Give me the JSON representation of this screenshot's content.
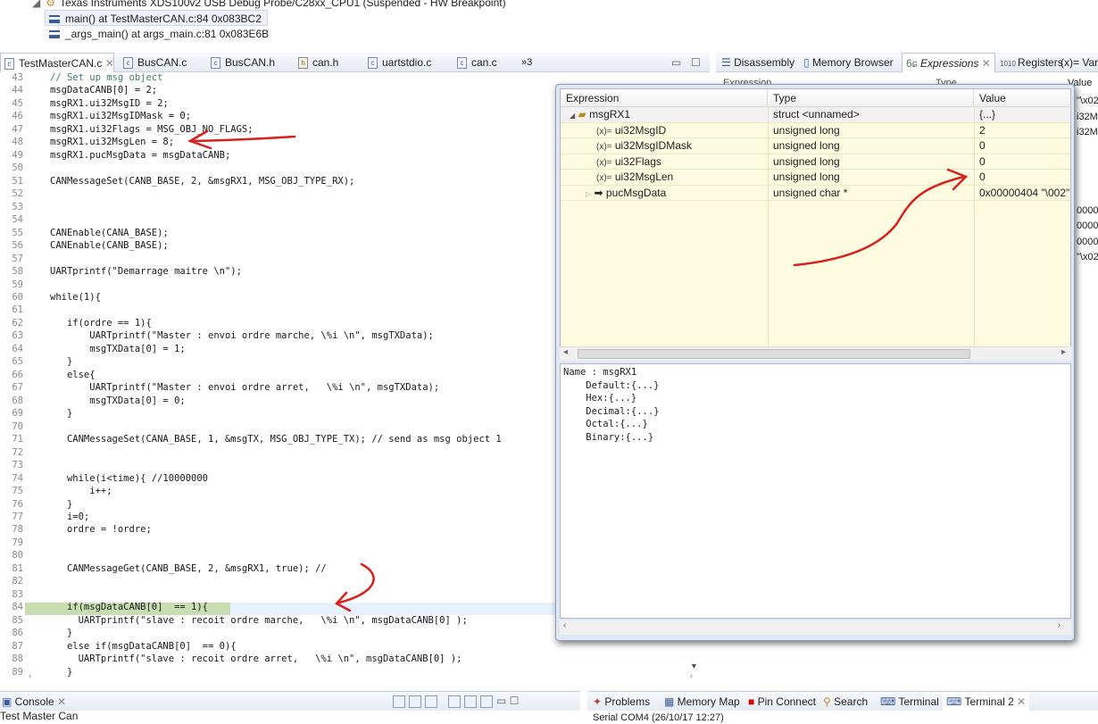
{
  "debug": {
    "target": "Texas Instruments XDS100v2 USB Debug Probe/C28xx_CPU1 (Suspended - HW Breakpoint)",
    "frames": [
      "main() at TestMasterCAN.c:84 0x083BC2",
      "_args_main() at args_main.c:81 0x083E6B"
    ]
  },
  "editor": {
    "tabs": [
      {
        "label": "TestMasterCAN.c",
        "icon": "c-file-icon",
        "active": true
      },
      {
        "label": "BusCAN.c",
        "icon": "c-file-icon"
      },
      {
        "label": "BusCAN.h",
        "icon": "c-file-icon"
      },
      {
        "label": "can.h",
        "icon": "h-file-icon"
      },
      {
        "label": "uartstdio.c",
        "icon": "c-file-icon"
      },
      {
        "label": "can.c",
        "icon": "c-file-icon"
      }
    ],
    "overflow": "»3",
    "current_line": 84,
    "lines": [
      [
        "43",
        "// Set up msg object"
      ],
      [
        "44",
        "msgDataCANB[0] = 2;"
      ],
      [
        "45",
        "msgRX1.ui32MsgID = 2;"
      ],
      [
        "46",
        "msgRX1.ui32MsgIDMask = 0;"
      ],
      [
        "47",
        "msgRX1.ui32Flags = MSG_OBJ_NO_FLAGS;"
      ],
      [
        "48",
        "msgRX1.ui32MsgLen = 8;"
      ],
      [
        "49",
        "msgRX1.pucMsgData = msgDataCANB;"
      ],
      [
        "50",
        ""
      ],
      [
        "51",
        "CANMessageSet(CANB_BASE, 2, &msgRX1, MSG_OBJ_TYPE_RX);"
      ],
      [
        "52",
        ""
      ],
      [
        "53",
        ""
      ],
      [
        "54",
        ""
      ],
      [
        "55",
        "CANEnable(CANA_BASE);"
      ],
      [
        "56",
        "CANEnable(CANB_BASE);"
      ],
      [
        "57",
        ""
      ],
      [
        "58",
        "UARTprintf(\"Demarrage maitre \\n\");"
      ],
      [
        "59",
        ""
      ],
      [
        "60",
        "while(1){"
      ],
      [
        "61",
        ""
      ],
      [
        "62",
        "   if(ordre == 1){"
      ],
      [
        "63",
        "       UARTprintf(\"Master : envoi ordre marche, \\%i \\n\", msgTXData);"
      ],
      [
        "64",
        "       msgTXData[0] = 1;"
      ],
      [
        "65",
        "   }"
      ],
      [
        "66",
        "   else{"
      ],
      [
        "67",
        "       UARTprintf(\"Master : envoi ordre arret,   \\%i \\n\", msgTXData);"
      ],
      [
        "68",
        "       msgTXData[0] = 0;"
      ],
      [
        "69",
        "   }"
      ],
      [
        "70",
        ""
      ],
      [
        "71",
        "   CANMessageSet(CANA_BASE, 1, &msgTX, MSG_OBJ_TYPE_TX); // send as msg object 1"
      ],
      [
        "72",
        ""
      ],
      [
        "73",
        ""
      ],
      [
        "74",
        "   while(i<time){ //10000000"
      ],
      [
        "75",
        "       i++;"
      ],
      [
        "76",
        "   }"
      ],
      [
        "77",
        "   i=0;"
      ],
      [
        "78",
        "   ordre = !ordre;"
      ],
      [
        "79",
        ""
      ],
      [
        "80",
        ""
      ],
      [
        "81",
        "   CANMessageGet(CANB_BASE, 2, &msgRX1, true); //"
      ],
      [
        "82",
        ""
      ],
      [
        "83",
        ""
      ],
      [
        "84",
        "   if(msgDataCANB[0]  == 1){"
      ],
      [
        "85",
        "     UARTprintf(\"slave : recoit ordre marche,   \\%i \\n\", msgDataCANB[0] );"
      ],
      [
        "86",
        "   }"
      ],
      [
        "87",
        "   else if(msgDataCANB[0]  == 0){"
      ],
      [
        "88",
        "     UARTprintf(\"slave : recoit ordre arret,   \\%i \\n\", msgDataCANB[0] );"
      ],
      [
        "89",
        "   }"
      ]
    ]
  },
  "right_tabs": [
    {
      "label": "Disassembly",
      "icon": "disassembly-icon"
    },
    {
      "label": "Memory Browser",
      "icon": "memory-icon"
    },
    {
      "label": "Expressions",
      "icon": "expressions-icon",
      "active": true
    },
    {
      "label": "Registers",
      "icon": "registers-icon"
    },
    {
      "label": "(x)= Vari",
      "icon": "variables-icon"
    }
  ],
  "background_panel": {
    "headers": [
      "Expression",
      "Type",
      "Value"
    ],
    "values": [
      "\"\\x02",
      "i32M",
      "i32M",
      "0000",
      "0000",
      "0000",
      "\"\\x02"
    ]
  },
  "popup": {
    "columns": [
      "Expression",
      "Type",
      "Value"
    ],
    "rows": [
      {
        "name": "msgRX1",
        "type": "struct <unnamed>",
        "value": "{...}",
        "icon": "struct-icon",
        "expanded": true,
        "level": 0
      },
      {
        "name": "ui32MsgID",
        "type": "unsigned long",
        "value": "2",
        "icon": "variable-icon",
        "level": 1
      },
      {
        "name": "ui32MsgIDMask",
        "type": "unsigned long",
        "value": "0",
        "icon": "variable-icon",
        "level": 1
      },
      {
        "name": "ui32Flags",
        "type": "unsigned long",
        "value": "0",
        "icon": "variable-icon",
        "level": 1
      },
      {
        "name": "ui32MsgLen",
        "type": "unsigned long",
        "value": "0",
        "icon": "variable-icon",
        "level": 1
      },
      {
        "name": "pucMsgData",
        "type": "unsigned char *",
        "value": "0x00000404 \"\\002\"",
        "icon": "pointer-icon",
        "level": 1,
        "collapsed": true
      }
    ],
    "detail": "Name : msgRX1\n    Default:{...}\n    Hex:{...}\n    Decimal:{...}\n    Octal:{...}\n    Binary:{...}"
  },
  "bottom": {
    "console_tab": "Console",
    "console_text": "Test Master Can",
    "tabs": [
      "Problems",
      "Memory Map",
      "Pin Connect",
      "Search",
      "Terminal",
      "Terminal 2"
    ],
    "terminal_sub": "Serial COM4 (26/10/17 12:27)"
  },
  "annotation_color": "#d8201c"
}
